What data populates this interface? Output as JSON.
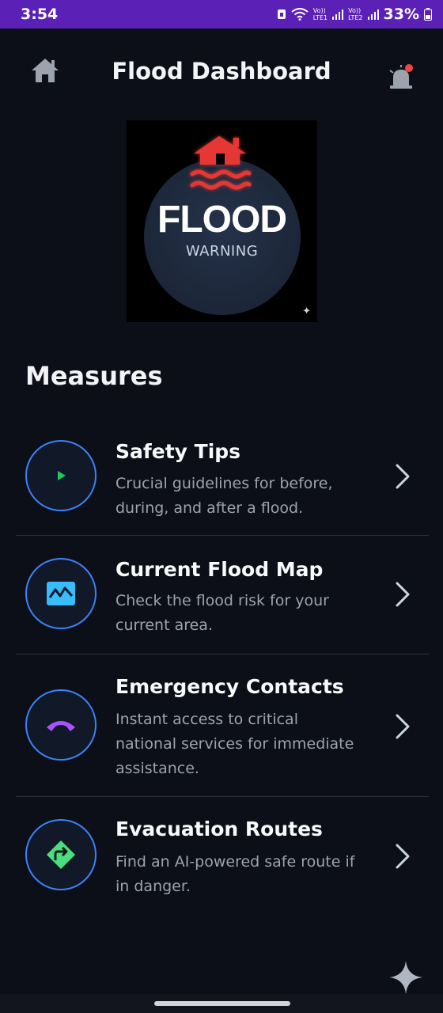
{
  "status_bar": {
    "time": "3:54",
    "net1_top": "Vo))",
    "net1_bottom": "LTE1",
    "net2_top": "Vo))",
    "net2_bottom": "LTE2",
    "battery": "33%"
  },
  "header": {
    "title": "Flood Dashboard",
    "left_icon": "home-icon",
    "right_icon": "alarm-icon"
  },
  "hero": {
    "line1": "FLOOD",
    "line2": "WARNING",
    "accent_color": "#e53935"
  },
  "section": {
    "title": "Measures"
  },
  "measures": [
    {
      "icon": "play-icon",
      "label": "Safety Tips",
      "desc_lines": [
        "Crucial guidelines for before,",
        "during, and after a flood."
      ]
    },
    {
      "icon": "map-chart-icon",
      "label": "Current Flood Map",
      "desc_lines": [
        "Check the flood risk for your",
        "current area."
      ]
    },
    {
      "icon": "phone-icon",
      "label": "Emergency Contacts",
      "desc_lines": [
        "Instant access to critical",
        "national services for immediate",
        "assistance."
      ]
    },
    {
      "icon": "route-icon",
      "label": "Evacuation Routes",
      "desc_lines": [
        "Find an AI-powered safe route if",
        "in danger."
      ]
    }
  ],
  "colors": {
    "background": "#0c0f17",
    "status_bar": "#5b21b6",
    "circle_border": "#3b82f6",
    "play": "#22c55e",
    "map": "#38bdf8",
    "phone": "#a855f7",
    "route": "#4ade80"
  }
}
